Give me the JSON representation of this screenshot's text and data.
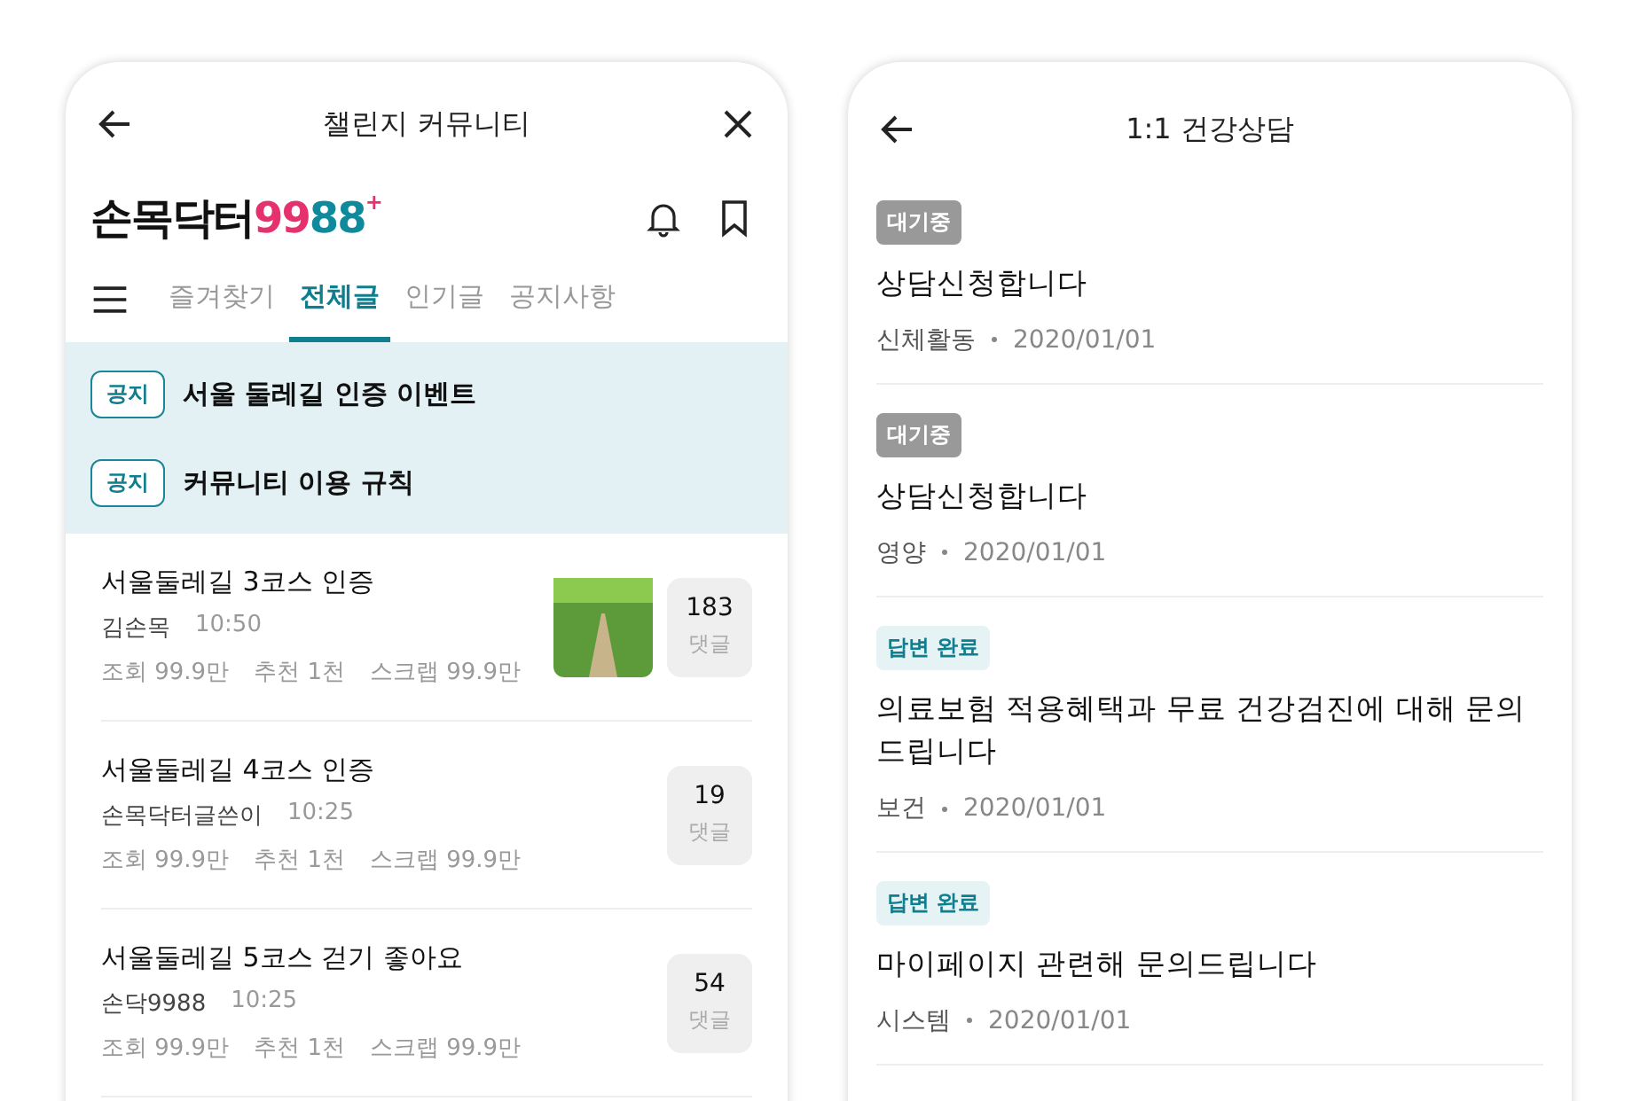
{
  "community_screen": {
    "title": "챌린지 커뮤니티",
    "logo": [
      {
        "text": "손목닥터",
        "color": "#111111"
      },
      {
        "text": "99",
        "color": "#e5326e"
      },
      {
        "text": "88",
        "color": "#0f8a9d"
      },
      {
        "text": "+",
        "color": "#e5326e"
      }
    ],
    "tabs": [
      {
        "label": "즐겨찾기",
        "selected": false
      },
      {
        "label": "전체글",
        "selected": true
      },
      {
        "label": "인기글",
        "selected": false
      },
      {
        "label": "공지사항",
        "selected": false
      }
    ],
    "notices": [
      {
        "tag": "공지",
        "title": "서울 둘레길 인증 이벤트"
      },
      {
        "tag": "공지",
        "title": "커뮤니티 이용 규칙"
      }
    ],
    "posts": [
      {
        "title": "서울둘레길 3코스 인증",
        "author": "김손목",
        "time": "10:50",
        "views": "조회 99.9만",
        "likes": "추천 1천",
        "scraps": "스크랩 99.9만",
        "has_photo": true,
        "comments": "183",
        "comments_label": "댓글"
      },
      {
        "title": "서울둘레길 4코스 인증",
        "author": "손목닥터글쓴이",
        "time": "10:25",
        "views": "조회 99.9만",
        "likes": "추천 1천",
        "scraps": "스크랩 99.9만",
        "has_photo": false,
        "comments": "19",
        "comments_label": "댓글"
      },
      {
        "title": "서울둘레길 5코스 걷기 좋아요",
        "author": "손닥9988",
        "time": "10:25",
        "views": "조회 99.9만",
        "likes": "추천 1천",
        "scraps": "스크랩 99.9만",
        "has_photo": false,
        "comments": "54",
        "comments_label": "댓글"
      }
    ]
  },
  "consult_screen": {
    "title": "1:1 건강상담",
    "items": [
      {
        "kind": "waiting",
        "status": "대기중",
        "title": "상담신청합니다",
        "category": "신체활동",
        "date": "2020/01/01"
      },
      {
        "kind": "waiting",
        "status": "대기중",
        "title": "상담신청합니다",
        "category": "영양",
        "date": "2020/01/01"
      },
      {
        "kind": "answered",
        "status": "답변 완료",
        "title": "의료보험 적용혜택과 무료 건강검진에 대해 문의드립니다",
        "category": "보건",
        "date": "2020/01/01"
      },
      {
        "kind": "answered",
        "status": "답변 완료",
        "title": "마이페이지 관련해 문의드립니다",
        "category": "시스템",
        "date": "2020/01/01"
      }
    ]
  }
}
